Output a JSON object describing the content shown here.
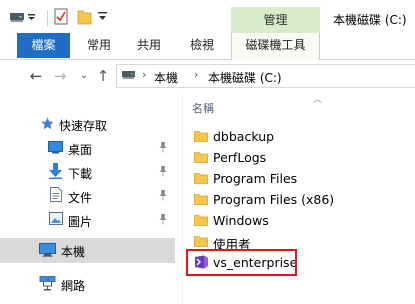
{
  "quick_access": {
    "manage_tab": "管理"
  },
  "window": {
    "title": "本機磁碟 (C:)"
  },
  "ribbon": {
    "file_tab": "檔案",
    "tabs": [
      "常用",
      "共用",
      "檢視"
    ],
    "drive_tools_tab": "磁碟機工具"
  },
  "address": {
    "crumbs": [
      "本機",
      "本機磁碟 (C:)"
    ]
  },
  "nav_pane": {
    "quick_access_label": "快速存取",
    "items": [
      {
        "label": "桌面",
        "icon": "desktop-icon",
        "pinned": true
      },
      {
        "label": "下載",
        "icon": "download-icon",
        "pinned": true
      },
      {
        "label": "文件",
        "icon": "document-icon",
        "pinned": true
      },
      {
        "label": "圖片",
        "icon": "pictures-icon",
        "pinned": true
      }
    ],
    "this_pc": "本機",
    "network": "網路"
  },
  "file_list": {
    "column_name": "名稱",
    "items": [
      {
        "name": "dbbackup",
        "icon": "folder-icon"
      },
      {
        "name": "PerfLogs",
        "icon": "folder-icon"
      },
      {
        "name": "Program Files",
        "icon": "folder-icon"
      },
      {
        "name": "Program Files (x86)",
        "icon": "folder-icon"
      },
      {
        "name": "Windows",
        "icon": "folder-icon"
      },
      {
        "name": "使用者",
        "icon": "folder-icon"
      },
      {
        "name": "vs_enterprise",
        "icon": "visual-studio-installer-icon"
      }
    ]
  },
  "colors": {
    "file_tab": "#1f6ec3",
    "manage_tab": "#d6eccb",
    "folder": "#f5c74d",
    "highlight": "#e0161d",
    "selected_nav": "#d9d9d9"
  }
}
